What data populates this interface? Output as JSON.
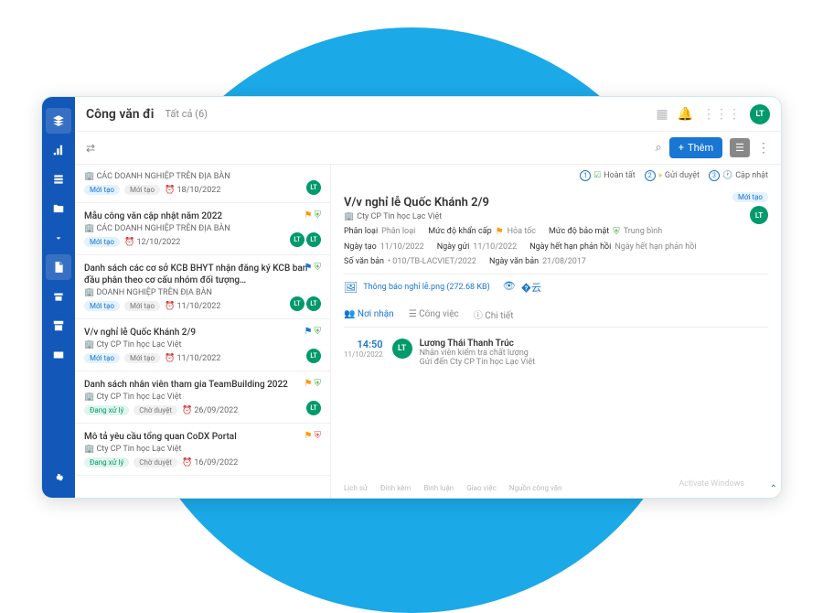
{
  "header": {
    "title": "Công văn đi",
    "filter": "Tất cả (6)",
    "avatar": "LT"
  },
  "toolbar": {
    "add_label": "Thêm"
  },
  "steps": [
    {
      "num": "1",
      "label": "Hoàn tất"
    },
    {
      "num": "2",
      "label": "Gửi duyệt"
    },
    {
      "num": "3",
      "label": "Cập nhật"
    }
  ],
  "list": [
    {
      "title": "",
      "sub": "CÁC DOANH NGHIỆP TRÊN ĐỊA BÀN",
      "b1": "Mới tạo",
      "b2": "Mới tạo",
      "date": "18/10/2022",
      "avatars": [
        "LT"
      ],
      "flags": []
    },
    {
      "title": "Mẫu công văn cập nhật năm 2022",
      "sub": "CÁC DOANH NGHIỆP TRÊN ĐỊA BÀN",
      "b1": "Mới tạo",
      "b2": "",
      "date": "12/10/2022",
      "avatars": [
        "LT",
        "LT"
      ],
      "flags": [
        "orange",
        "shield"
      ]
    },
    {
      "title": "Danh sách các cơ sở KCB BHYT nhận đăng ký KCB ban đầu phân theo cơ cấu nhóm đối tượng…",
      "sub": "DOANH NGHIỆP TRÊN ĐỊA BÀN",
      "b1": "Mới tạo",
      "b2": "Mới tạo",
      "date": "11/10/2022",
      "avatars": [
        "LT",
        "LT"
      ],
      "flags": [
        "blue",
        "shield"
      ]
    },
    {
      "title": "V/v nghỉ lễ Quốc Khánh 2/9",
      "sub": "Cty CP Tin học Lạc Việt",
      "b1": "Mới tạo",
      "b2": "Mới tạo",
      "date": "11/10/2022",
      "avatars": [
        "LT"
      ],
      "flags": [
        "blue",
        "shield"
      ]
    },
    {
      "title": "Danh sách nhân viên tham gia TeamBuilding 2022",
      "sub": "Cty CP Tin học Lạc Việt",
      "b1": "Đang xử lý",
      "b2": "Chờ duyệt",
      "date": "26/09/2022",
      "avatars": [
        "LT"
      ],
      "flags": [
        "orange",
        "shield"
      ],
      "green": true
    },
    {
      "title": "Mô tả yêu cầu tổng quan CoDX Portal",
      "sub": "Cty CP Tin học Lạc Việt",
      "b1": "Đang xử lý",
      "b2": "Chờ duyệt",
      "date": "16/09/2022",
      "avatars": [],
      "flags": [
        "orange",
        "shield-red"
      ],
      "green": true
    }
  ],
  "detail": {
    "title": "V/v nghỉ lễ Quốc Khánh 2/9",
    "company": "Cty CP Tin học Lạc Việt",
    "badge": "Mới tạo",
    "meta1": [
      {
        "label": "Phân loại",
        "val": "Phân loại"
      },
      {
        "label": "Mức độ khẩn cấp",
        "val": "Hỏa tốc",
        "flag": true
      },
      {
        "label": "Mức độ bảo mật",
        "val": "Trung bình",
        "shield": true
      }
    ],
    "meta2": [
      {
        "label": "Ngày tạo",
        "val": "11/10/2022"
      },
      {
        "label": "Ngày gửi",
        "val": "11/10/2022"
      },
      {
        "label": "Ngày hết hạn phản hồi",
        "val": "Ngày hết hạn phản hồi"
      }
    ],
    "meta3": [
      {
        "label": "Số văn bản",
        "val": "• 010/TB-LACVIET/2022"
      },
      {
        "label": "Ngày văn bản",
        "val": "21/08/2017"
      }
    ],
    "file": {
      "name": "Thông báo nghỉ lễ.png (272.68 KB)"
    },
    "tabs": [
      "Nơi nhận",
      "Công việc",
      "Chi tiết"
    ],
    "recipient": {
      "time": "14:50",
      "date": "11/10/2022",
      "avatar": "LT",
      "name": "Lương Thái Thanh Trúc",
      "role": "Nhân viên kiểm tra chất lượng",
      "sent": "Gửi đến Cty CP Tin học Lạc Việt"
    },
    "footer_tabs": [
      "Lịch sử",
      "Đính kèm",
      "Bình luận",
      "Giao việc",
      "Nguồn công văn"
    ]
  },
  "activate": "Activate Windows"
}
